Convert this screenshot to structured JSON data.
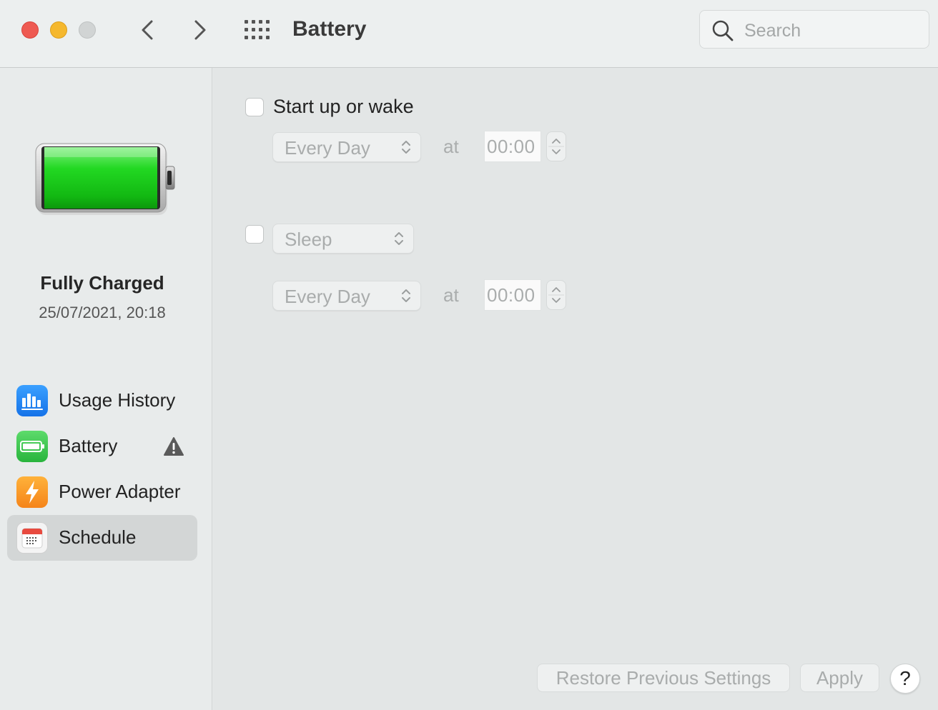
{
  "window": {
    "title": "Battery"
  },
  "search": {
    "placeholder": "Search",
    "value": ""
  },
  "status": {
    "title": "Fully Charged",
    "datetime": "25/07/2021, 20:18",
    "charge_level": 1.0
  },
  "sidebar": {
    "items": [
      {
        "label": "Usage History",
        "icon": "bar-chart-icon",
        "color": "#1e8cf5",
        "selected": false
      },
      {
        "label": "Battery",
        "icon": "battery-icon",
        "color": "#34c759",
        "selected": false,
        "warning": true
      },
      {
        "label": "Power Adapter",
        "icon": "lightning-icon",
        "color": "#f7971e",
        "selected": false
      },
      {
        "label": "Schedule",
        "icon": "calendar-icon",
        "color": "#e84a3f",
        "selected": true
      }
    ]
  },
  "schedule": {
    "startup": {
      "label": "Start up or wake",
      "checked": false,
      "frequency": "Every Day",
      "at_label": "at",
      "time": "00:00"
    },
    "sleep": {
      "action": "Sleep",
      "checked": false,
      "frequency": "Every Day",
      "at_label": "at",
      "time": "00:00"
    }
  },
  "footer": {
    "restore_label": "Restore Previous Settings",
    "apply_label": "Apply",
    "help_label": "?"
  },
  "colors": {
    "close": "#ee5a52",
    "minimize": "#f5b82e",
    "zoom_disabled": "#d1d4d4",
    "battery_green": "#2fd62f"
  }
}
